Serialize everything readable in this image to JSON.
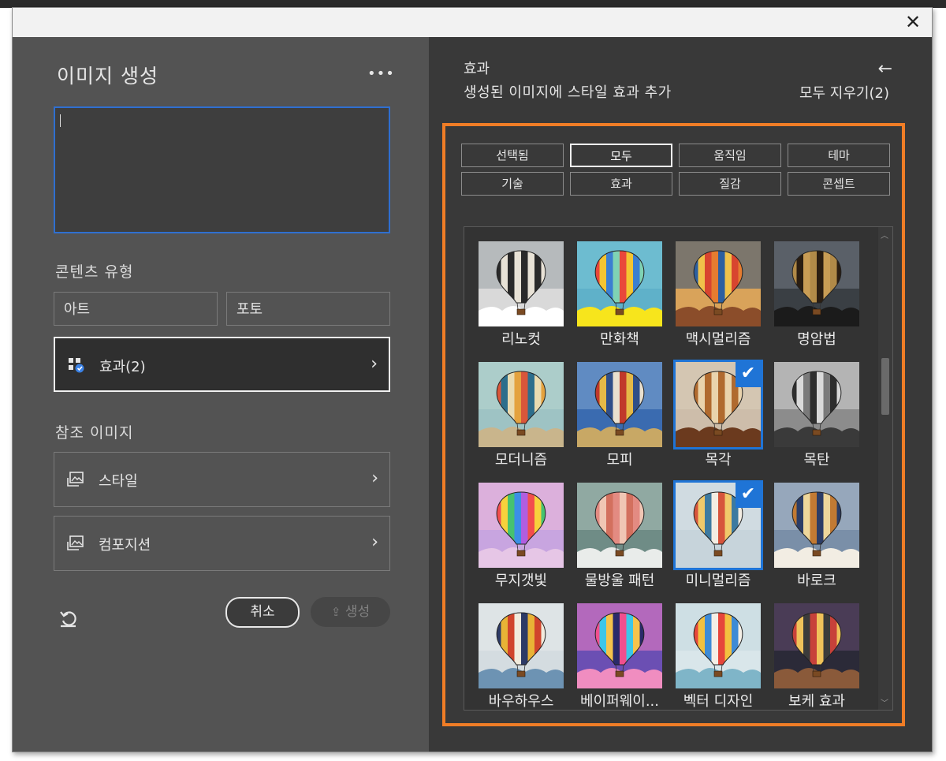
{
  "window": {
    "close_label": "✕"
  },
  "panel": {
    "title": "이미지 생성",
    "more_label": "•••",
    "prompt_value": "",
    "content_type_heading": "콘텐츠 유형",
    "content_types": [
      "아트",
      "포토"
    ],
    "effects_button": "효과(2)",
    "reference_heading": "참조 이미지",
    "style_button": "스타일",
    "composition_button": "컴포지션",
    "cancel_label": "취소",
    "generate_label": "생성"
  },
  "effects_panel": {
    "title": "효과",
    "subtitle": "생성된 이미지에 스타일 효과 추가",
    "back_label": "←",
    "clear_all_label": "모두 지우기(2)",
    "filters": [
      "선택됨",
      "모두",
      "움직임",
      "테마",
      "기술",
      "효과",
      "질감",
      "콘셉트"
    ],
    "active_filter": "모두",
    "tiles": [
      {
        "label": "리노컷",
        "selected": false,
        "style": "linocut"
      },
      {
        "label": "만화책",
        "selected": false,
        "style": "comic"
      },
      {
        "label": "맥시멀리즘",
        "selected": false,
        "style": "maximal"
      },
      {
        "label": "명암법",
        "selected": false,
        "style": "chiaro"
      },
      {
        "label": "모더니즘",
        "selected": false,
        "style": "modern"
      },
      {
        "label": "모피",
        "selected": false,
        "style": "fur"
      },
      {
        "label": "목각",
        "selected": true,
        "style": "woodcarve"
      },
      {
        "label": "목탄",
        "selected": false,
        "style": "charcoal"
      },
      {
        "label": "무지갯빛",
        "selected": false,
        "style": "rainbow"
      },
      {
        "label": "물방울 패턴",
        "selected": false,
        "style": "dots"
      },
      {
        "label": "미니멀리즘",
        "selected": true,
        "style": "minimal"
      },
      {
        "label": "바로크",
        "selected": false,
        "style": "baroque"
      },
      {
        "label": "바우하우스",
        "selected": false,
        "style": "bauhaus"
      },
      {
        "label": "베이퍼웨이...",
        "selected": false,
        "style": "vapor"
      },
      {
        "label": "벡터 디자인",
        "selected": false,
        "style": "vector"
      },
      {
        "label": "보케 효과",
        "selected": false,
        "style": "bokeh"
      }
    ]
  },
  "tile_palettes": {
    "linocut": {
      "bg": "#d9d9d9",
      "sky": "#9fa5a8",
      "stripes": [
        "#2a2a2a",
        "#e8e2d6"
      ],
      "ground": "#ffffff"
    },
    "comic": {
      "bg": "#5fb1c9",
      "sky": "#77c3d6",
      "stripes": [
        "#e9473b",
        "#f4c531",
        "#3b7fd1",
        "#7fd3b4"
      ],
      "ground": "#f7e51c"
    },
    "maximal": {
      "bg": "#d9a35a",
      "sky": "#3e5978",
      "stripes": [
        "#2c5fa0",
        "#f0c24a",
        "#d8452f",
        "#e57c30"
      ],
      "ground": "#8b4d2a"
    },
    "chiaro": {
      "bg": "#3a3f44",
      "sky": "#6f7680",
      "stripes": [
        "#b18a48",
        "#2b1e12",
        "#c99d55"
      ],
      "ground": "#1b1b1b"
    },
    "modern": {
      "bg": "#9ec3c4",
      "sky": "#b6d3cf",
      "stripes": [
        "#d8563a",
        "#2d6e8c",
        "#eadbb0",
        "#e4a23e"
      ],
      "ground": "#c9b58c"
    },
    "fur": {
      "bg": "#3a6bb0",
      "sky": "#7aa0cf",
      "stripes": [
        "#c0392b",
        "#e5b947",
        "#2f4e88",
        "#e9e0cf"
      ],
      "ground": "#c8a865"
    },
    "woodcarve": {
      "bg": "#cdbdaa",
      "sky": "#d9cbb8",
      "stripes": [
        "#b06a2f",
        "#e9d3ad"
      ],
      "ground": "#6b3a1e"
    },
    "charcoal": {
      "bg": "#8c8c8c",
      "sky": "#cfcfcf",
      "stripes": [
        "#2e2e2e",
        "#d9d9d9",
        "#7a7a7a"
      ],
      "ground": "#3a3a3a"
    },
    "rainbow": {
      "bg": "#c8a5e0",
      "sky": "#e9b8d8",
      "stripes": [
        "#f24e4e",
        "#f7d23c",
        "#46c26f",
        "#3b8fe6",
        "#b05ee0"
      ],
      "ground": "#e6c6e6"
    },
    "dots": {
      "bg": "#6f8c86",
      "sky": "#a7bdb6",
      "stripes": [
        "#e38b82",
        "#f0c6b4",
        "#d3705e"
      ],
      "ground": "#e9ecea"
    },
    "minimal": {
      "bg": "#c7d4db",
      "sky": "#d5e0e4",
      "stripes": [
        "#d6543c",
        "#f0c96a",
        "#3d7aa0",
        "#f3ede3"
      ],
      "ground": "#c7d4db"
    },
    "baroque": {
      "bg": "#7a8fa8",
      "sky": "#a8b8c8",
      "stripes": [
        "#c27a33",
        "#2c3d66",
        "#eed79b"
      ],
      "ground": "#f2ede3"
    },
    "bauhaus": {
      "bg": "#d4dce0",
      "sky": "#e5e9ea",
      "stripes": [
        "#2d3a66",
        "#e8b336",
        "#d0442c",
        "#f1ebdd"
      ],
      "ground": "#6d93b3"
    },
    "vapor": {
      "bg": "#6b4fb3",
      "sky": "#e27cc2",
      "stripes": [
        "#f04f8e",
        "#3cc6e8",
        "#f5c34b",
        "#2a2a6a"
      ],
      "ground": "#f08dc0"
    },
    "vector": {
      "bg": "#d9e6ea",
      "sky": "#c6dbe0",
      "stripes": [
        "#e6463b",
        "#f3c13f",
        "#3e8bd6",
        "#f4efe6"
      ],
      "ground": "#7fb5c8"
    },
    "bokeh": {
      "bg": "#2b2a38",
      "sky": "#5f4a6b",
      "stripes": [
        "#c7413a",
        "#f0c25a",
        "#3b3b3b"
      ],
      "ground": "#8a5a3a"
    }
  }
}
